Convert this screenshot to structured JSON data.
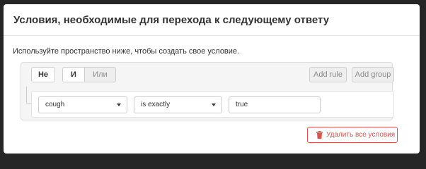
{
  "modal": {
    "title": "Условия, необходимые для перехода к следующему ответу",
    "description": "Используйте пространство ниже, чтобы создать свое условие."
  },
  "query_builder": {
    "not_label": "Не",
    "and_label": "И",
    "or_label": "Или",
    "add_rule_label": "Add rule",
    "add_group_label": "Add group",
    "rule": {
      "field_value": "cough",
      "operator_value": "is exactly",
      "value": "true"
    }
  },
  "footer": {
    "delete_all_label": "Удалить все условия"
  },
  "icons": {
    "trash": "trash-icon",
    "dropdown": "chevron-down-icon"
  },
  "colors": {
    "danger": "#d9534f",
    "backdrop": "#262626"
  }
}
